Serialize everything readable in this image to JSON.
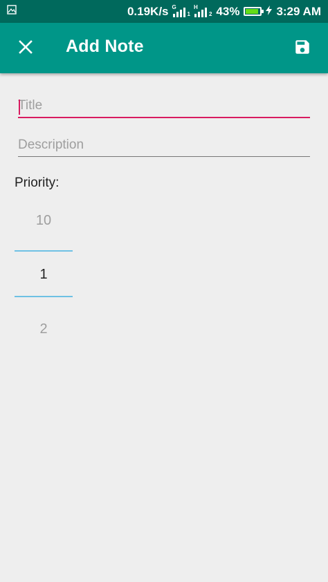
{
  "status_bar": {
    "speed": "0.19K/s",
    "net1_tag": "G",
    "net1_sub": "1",
    "net2_tag": "H",
    "net2_sub": "2",
    "battery": "43%",
    "time": "3:29 AM"
  },
  "app_bar": {
    "title": "Add Note",
    "close_icon": "close-icon",
    "save_icon": "save-icon"
  },
  "form": {
    "title_placeholder": "Title",
    "title_value": "",
    "description_placeholder": "Description",
    "description_value": "",
    "priority_label": "Priority:",
    "picker": {
      "prev": "10",
      "current": "1",
      "next": "2"
    }
  },
  "colors": {
    "status_bar": "#00695c",
    "app_bar": "#009688",
    "accent": "#d81b60",
    "picker_divider": "#6ec1e4",
    "background": "#eeeeee"
  }
}
